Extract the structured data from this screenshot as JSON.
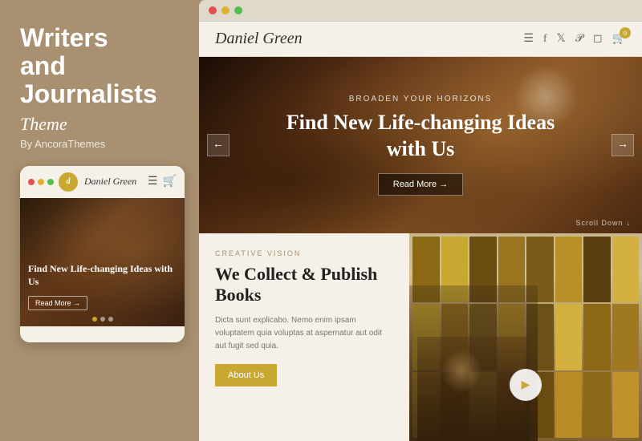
{
  "left": {
    "title_line1": "Writers",
    "title_line2": "and",
    "title_line3": "Journalists",
    "subtitle": "Theme",
    "byline": "By AncoraThemes",
    "mobile_logo": "Daniel Green",
    "mobile_hero_title": "Find New Life-changing Ideas with Us",
    "mobile_read_btn": "Read More →"
  },
  "browser": {
    "site_logo": "Daniel Green",
    "hero_subtitle": "BROADEN YOUR HORIZONS",
    "hero_title": "Find New Life-changing Ideas with Us",
    "hero_btn": "Read More →",
    "scroll_down": "Scroll Down",
    "creative_label": "CREATIVE VISION",
    "content_heading": "We Collect & Publish Books",
    "content_body": "Dicta sunt explicabo. Nemo enim ipsam voluptatem quia voluptas at aspernatur aut odit aut fugit sed quia.",
    "about_btn": "About Us",
    "arrow_prev": "←",
    "arrow_next": "→"
  },
  "colors": {
    "gold": "#c8a830",
    "brown_bg": "#a89070",
    "cream": "#f5f0e8"
  }
}
